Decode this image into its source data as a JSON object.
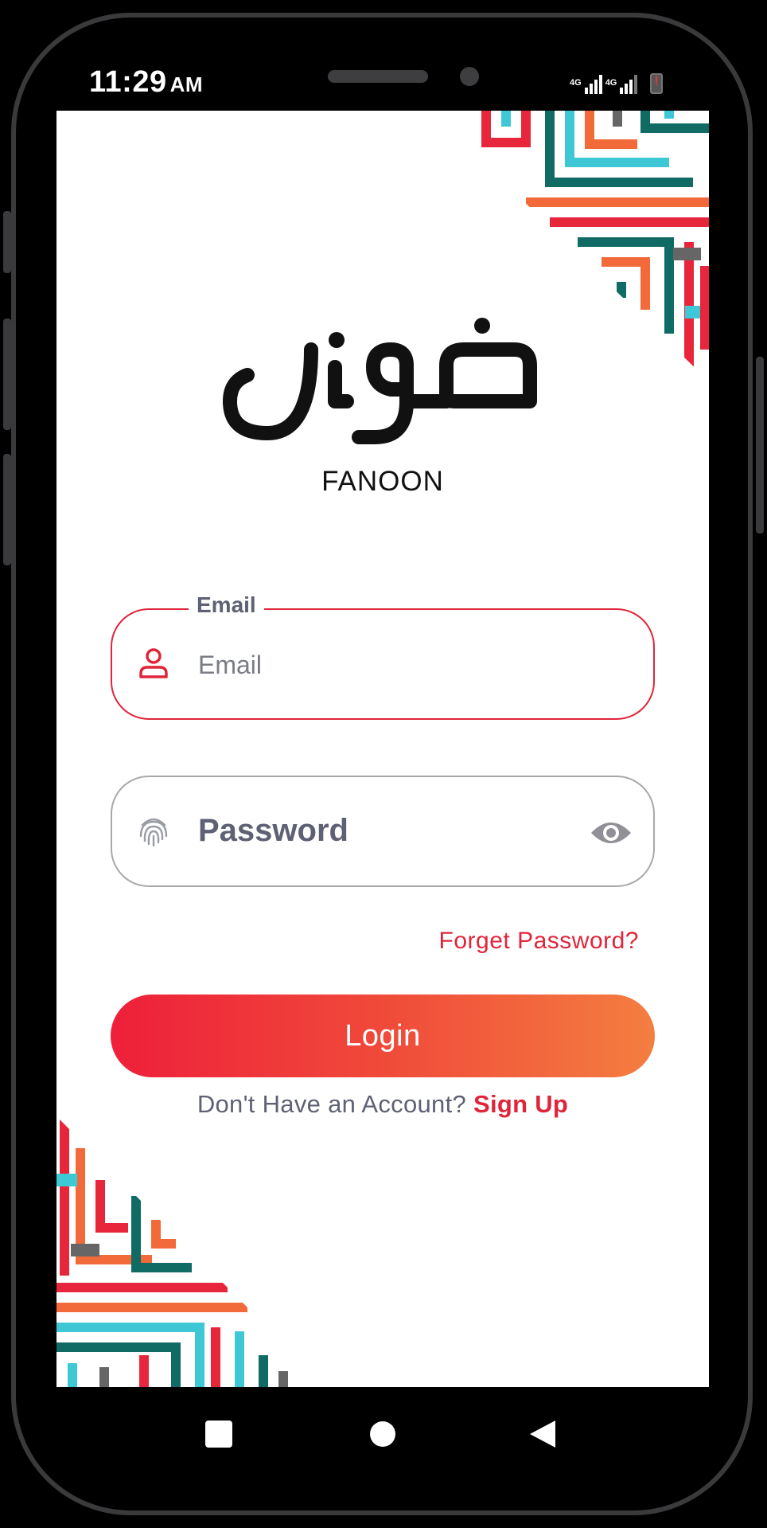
{
  "status_bar": {
    "time": "11:29",
    "ampm": "AM",
    "network_label_1": "4G",
    "network_label_2": "4G"
  },
  "app": {
    "logo_arabic": "فنون",
    "brand_name": "FANOON"
  },
  "email_field": {
    "legend": "Email",
    "placeholder": "Email",
    "value": ""
  },
  "password_field": {
    "placeholder": "Password",
    "value": ""
  },
  "forgot_password": "Forget Password?",
  "login_button": "Login",
  "signup": {
    "prompt": "Don't Have an Account?",
    "link": "Sign Up"
  },
  "icons": {
    "email": "person-icon",
    "password": "fingerprint-icon",
    "toggle": "eye-icon"
  },
  "colors": {
    "accent": "#e0253a",
    "button_gradient_start": "#ee1f3b",
    "button_gradient_end": "#f47e40",
    "pattern_teal": "#0f6b63",
    "pattern_cyan": "#3ec8d6",
    "pattern_orange": "#f26a3a",
    "pattern_red": "#e8263b",
    "pattern_gray": "#666666"
  }
}
